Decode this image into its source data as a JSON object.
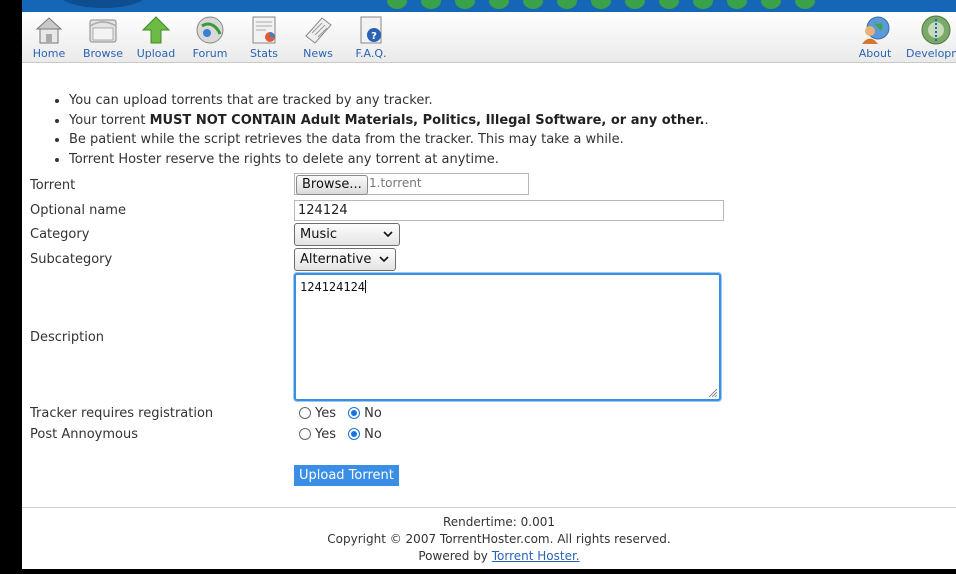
{
  "nav": {
    "left": [
      {
        "label": "Home",
        "icon": "house-icon"
      },
      {
        "label": "Browse",
        "icon": "folder-icon"
      },
      {
        "label": "Upload",
        "icon": "upload-arrow-icon"
      },
      {
        "label": "Forum",
        "icon": "globe-chat-icon"
      },
      {
        "label": "Stats",
        "icon": "chart-document-icon"
      },
      {
        "label": "News",
        "icon": "newspaper-icon"
      },
      {
        "label": "F.A.Q.",
        "icon": "help-document-icon"
      }
    ],
    "right": [
      {
        "label": "About",
        "icon": "people-globe-icon"
      },
      {
        "label": "Developm",
        "icon": "development-globe-icon"
      }
    ]
  },
  "notes": {
    "line1": "You can upload torrents that are tracked by any tracker.",
    "line2_pre": "Your torrent ",
    "line2_bold": "MUST NOT CONTAIN Adult Materials, Politics, Illegal Software, or any other.",
    "line2_post": ".",
    "line3": "Be patient while the script retrieves the data from the tracker. This may take a while.",
    "line4": "Torrent Hoster reserve the rights to delete any torrent at anytime."
  },
  "form": {
    "torrent_label": "Torrent",
    "browse_label": "Browse...",
    "file_name": "1.torrent",
    "optional_name_label": "Optional name",
    "optional_name_value": "124124",
    "category_label": "Category",
    "category_value": "Music",
    "subcategory_label": "Subcategory",
    "subcategory_value": "Alternative",
    "description_label": "Description",
    "description_value": "124124124",
    "tracker_reg_label": "Tracker requires registration",
    "post_anon_label": "Post Annoymous",
    "yes_label": "Yes",
    "no_label": "No",
    "tracker_reg_selected": "No",
    "post_anon_selected": "No",
    "submit_label": "Upload Torrent"
  },
  "footer": {
    "rendertime": "Rendertime: 0.001",
    "copyright": "Copyright © 2007 TorrentHoster.com. All rights reserved.",
    "powered_by": "Powered by ",
    "powered_link": "Torrent Hoster."
  },
  "colors": {
    "accent": "#3a8ee6",
    "link": "#2a63b5",
    "banner": "#1666b8"
  }
}
